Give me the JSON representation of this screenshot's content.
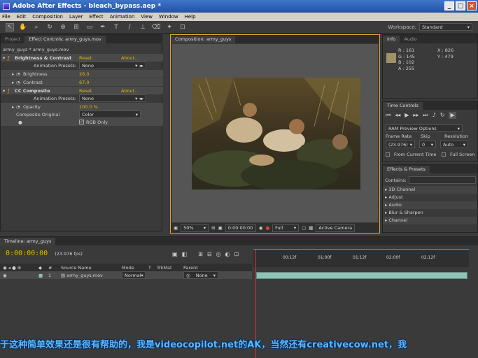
{
  "window": {
    "title": "Adobe After Effects - bleach_bypass.aep *"
  },
  "menu": [
    "File",
    "Edit",
    "Composition",
    "Layer",
    "Effect",
    "Animation",
    "View",
    "Window",
    "Help"
  ],
  "workspace": {
    "label": "Workspace:",
    "value": "Standard"
  },
  "left_panel": {
    "tabs": [
      "Project",
      "Effect Controls: army_guys.mov"
    ],
    "breadcrumb": "army_guys * army_guys.mov",
    "effects": [
      {
        "name": "Brightness & Contrast",
        "reset": "Reset",
        "about": "About...",
        "rows": [
          {
            "label": "Animation Presets:",
            "value": "None"
          },
          {
            "label": "Brightness",
            "value": "26.0"
          },
          {
            "label": "Contrast",
            "value": "67.0"
          }
        ]
      },
      {
        "name": "CC Composite",
        "reset": "Reset",
        "about": "About...",
        "rows": [
          {
            "label": "Animation Presets:",
            "value": "None"
          },
          {
            "label": "Opacity",
            "value": "100.0 %"
          },
          {
            "label": "Composite Original",
            "value": "Color"
          },
          {
            "label": "",
            "value": "RGB Only"
          }
        ]
      }
    ]
  },
  "comp": {
    "tab": "Composition: army_guys",
    "zoom": "50%",
    "timecode": "0:00:00:00",
    "resolution": "Full",
    "camera": "Active Camera"
  },
  "info": {
    "tabs": [
      "Info",
      "Audio"
    ],
    "r": "R : 161",
    "g": "G : 145",
    "b": "B : 102",
    "a": "A : 255",
    "x": "X : 826",
    "y": "Y : 479",
    "swatch_color": "#a09166"
  },
  "time_controls": {
    "tab": "Time Controls",
    "ram": "RAM Preview Options",
    "frame_rate_label": "Frame Rate",
    "skip_label": "Skip",
    "resolution_label": "Resolution",
    "frame_rate": "(23.976)",
    "skip": "0",
    "resolution": "Auto",
    "from_current": "From Current Time",
    "full_screen": "Full Screen"
  },
  "effects_presets": {
    "tab": "Effects & Presets",
    "contains_label": "Contains:",
    "items": [
      "3D Channel",
      "Adjust",
      "Audio",
      "Blur & Sharpen",
      "Channel"
    ]
  },
  "timeline": {
    "tab": "Timeline: army_guys",
    "timecode": "0:00:00:00",
    "fps": "(23.976 fps)",
    "columns": [
      "#",
      "Source Name",
      "Mode",
      "T",
      "TrkMat",
      "Parent"
    ],
    "layer": {
      "num": "1",
      "name": "army_guys.mov",
      "mode": "Normal",
      "parent": "None"
    },
    "ruler": [
      "00:12f",
      "01:00f",
      "01:12f",
      "02:00f",
      "02:12f"
    ]
  },
  "subtitle": "于这种简单效果还是很有帮助的，我是videocopilot.net的AK，当然还有creativecow.net，我"
}
